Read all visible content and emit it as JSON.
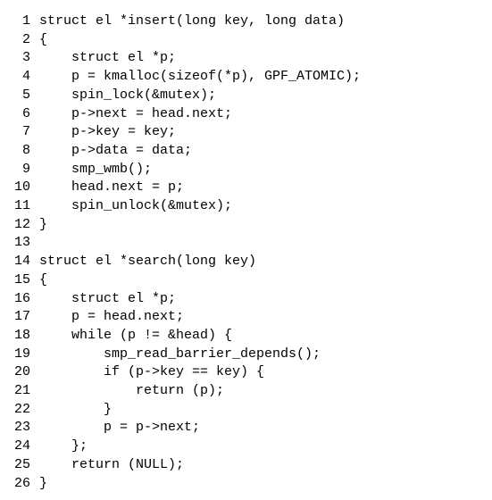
{
  "lines": [
    {
      "num": "1",
      "text": "struct el *insert(long key, long data)"
    },
    {
      "num": "2",
      "text": "{"
    },
    {
      "num": "3",
      "text": "    struct el *p;"
    },
    {
      "num": "4",
      "text": "    p = kmalloc(sizeof(*p), GPF_ATOMIC);"
    },
    {
      "num": "5",
      "text": "    spin_lock(&mutex);"
    },
    {
      "num": "6",
      "text": "    p->next = head.next;"
    },
    {
      "num": "7",
      "text": "    p->key = key;"
    },
    {
      "num": "8",
      "text": "    p->data = data;"
    },
    {
      "num": "9",
      "text": "    smp_wmb();"
    },
    {
      "num": "10",
      "text": "    head.next = p;"
    },
    {
      "num": "11",
      "text": "    spin_unlock(&mutex);"
    },
    {
      "num": "12",
      "text": "}"
    },
    {
      "num": "13",
      "text": ""
    },
    {
      "num": "14",
      "text": "struct el *search(long key)"
    },
    {
      "num": "15",
      "text": "{"
    },
    {
      "num": "16",
      "text": "    struct el *p;"
    },
    {
      "num": "17",
      "text": "    p = head.next;"
    },
    {
      "num": "18",
      "text": "    while (p != &head) {"
    },
    {
      "num": "19",
      "text": "        smp_read_barrier_depends();"
    },
    {
      "num": "20",
      "text": "        if (p->key == key) {"
    },
    {
      "num": "21",
      "text": "            return (p);"
    },
    {
      "num": "22",
      "text": "        }"
    },
    {
      "num": "23",
      "text": "        p = p->next;"
    },
    {
      "num": "24",
      "text": "    };"
    },
    {
      "num": "25",
      "text": "    return (NULL);"
    },
    {
      "num": "26",
      "text": "}"
    }
  ]
}
